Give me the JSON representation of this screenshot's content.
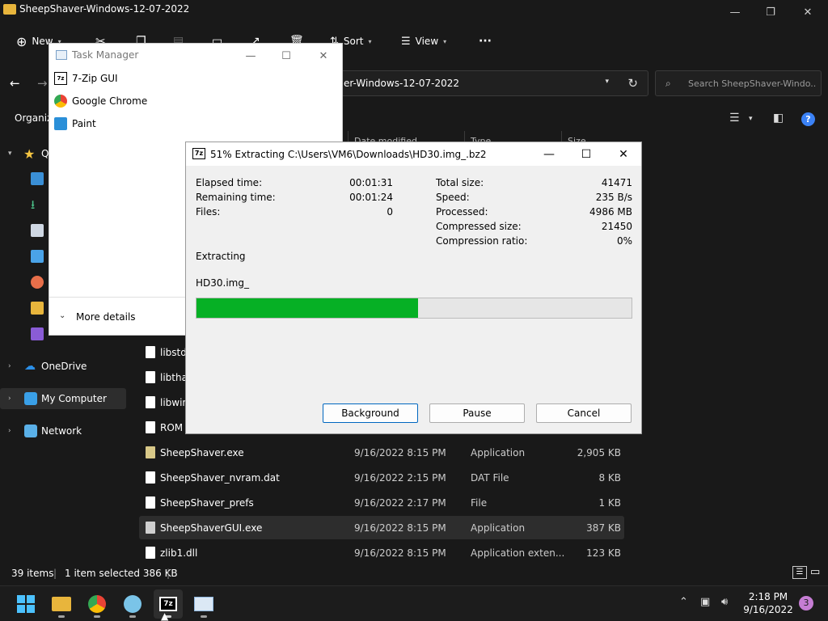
{
  "explorer": {
    "title": "SheepShaver-Windows-12-07-2022",
    "cmd": {
      "new": "New",
      "sort": "Sort",
      "view": "View",
      "more": "···"
    },
    "address": "er-Windows-12-07-2022",
    "search_placeholder": "Search SheepShaver-Windo...",
    "organize": "Organiz",
    "columns": {
      "date": "Date modified",
      "type": "Type",
      "size": "Size"
    },
    "nav": {
      "quick_access": "Q",
      "onedrive": "OneDrive",
      "my_computer": "My Computer",
      "network": "Network",
      "videos_partial": "Videos"
    },
    "files": [
      {
        "name": "libstdc",
        "date": "",
        "type": "",
        "size": ""
      },
      {
        "name": "libthai",
        "date": "",
        "type": "",
        "size": ""
      },
      {
        "name": "libwin",
        "date": "",
        "type": "",
        "size": ""
      },
      {
        "name": "ROM",
        "date": "",
        "type": "",
        "size": ""
      },
      {
        "name": "SheepShaver.exe",
        "date": "9/16/2022 8:15 PM",
        "type": "Application",
        "size": "2,905 KB"
      },
      {
        "name": "SheepShaver_nvram.dat",
        "date": "9/16/2022 2:15 PM",
        "type": "DAT File",
        "size": "8 KB"
      },
      {
        "name": "SheepShaver_prefs",
        "date": "9/16/2022 2:17 PM",
        "type": "File",
        "size": "1 KB"
      },
      {
        "name": "SheepShaverGUI.exe",
        "date": "9/16/2022 8:15 PM",
        "type": "Application",
        "size": "387 KB"
      },
      {
        "name": "zlib1.dll",
        "date": "9/16/2022 8:15 PM",
        "type": "Application exten...",
        "size": "123 KB"
      }
    ],
    "status": {
      "items": "39 items",
      "selected": "1 item selected  386 KB"
    }
  },
  "taskmgr": {
    "title": "Task Manager",
    "apps": [
      "7-Zip GUI",
      "Google Chrome",
      "Paint"
    ],
    "more_details": "More details"
  },
  "zip": {
    "title": "51% Extracting C:\\Users\\VM6\\Downloads\\HD30.img_.bz2",
    "left": [
      {
        "label": "Elapsed time:",
        "value": "00:01:31"
      },
      {
        "label": "Remaining time:",
        "value": "00:01:24"
      },
      {
        "label": "Files:",
        "value": "0"
      }
    ],
    "right": [
      {
        "label": "Total size:",
        "value": "41471"
      },
      {
        "label": "Speed:",
        "value": "235 B/s"
      },
      {
        "label": "Processed:",
        "value": "4986 MB"
      },
      {
        "label": "Compressed size:",
        "value": "21450"
      },
      {
        "label": "Compression ratio:",
        "value": "0%"
      }
    ],
    "status": "Extracting",
    "current_file": "HD30.img_",
    "progress": 0.51,
    "buttons": {
      "background": "Background",
      "pause": "Pause",
      "cancel": "Cancel"
    }
  },
  "taskbar": {
    "time": "2:18 PM",
    "date": "9/16/2022",
    "notifications": "3"
  },
  "colors": {
    "accent": "#0067c0",
    "progress": "#06b025",
    "folder": "#e8b53c"
  }
}
